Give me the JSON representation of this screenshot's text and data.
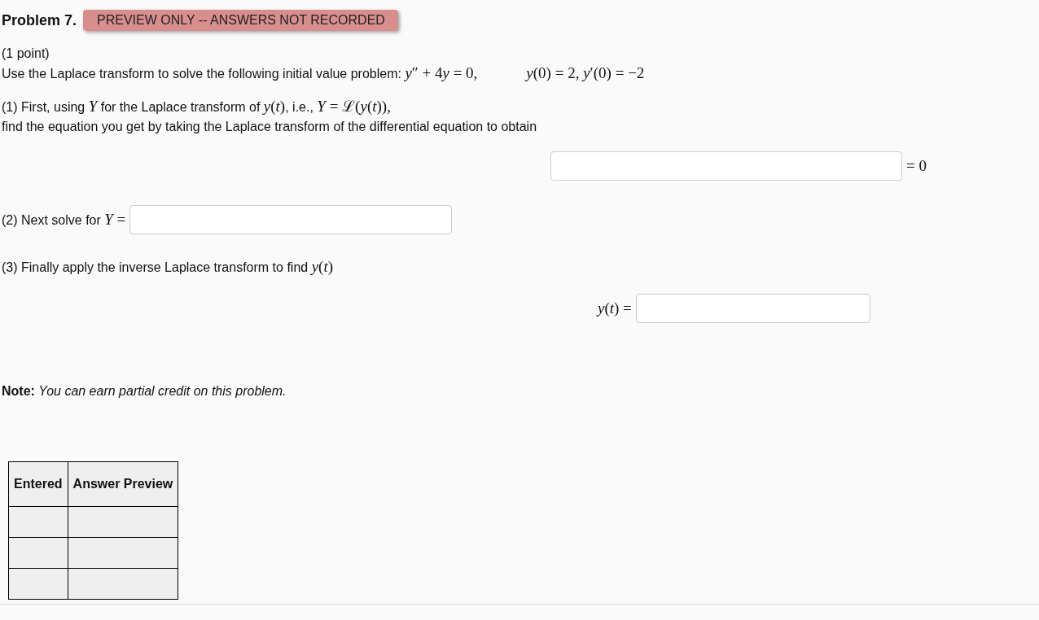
{
  "problem": {
    "title": "Problem 7.",
    "badge": "PREVIEW ONLY -- ANSWERS NOT RECORDED"
  },
  "points": "(1 point)",
  "statement": [
    {
      "kind": "text",
      "text": "Use the Laplace transform to solve the following initial value problem: "
    },
    {
      "kind": "math",
      "text": "*y*″ + 4"
    },
    {
      "kind": "math",
      "text": "*y* = 0,"
    },
    {
      "kind": "gap"
    },
    {
      "kind": "math",
      "text": "*y*(0) = 2,  *y*′(0) = −2"
    }
  ],
  "part1": {
    "line1": [
      {
        "kind": "text",
        "text": "(1) First, using "
      },
      {
        "kind": "math",
        "text": "*Y*"
      },
      {
        "kind": "text",
        "text": " for the Laplace transform of "
      },
      {
        "kind": "math",
        "text": "*y*(*t*)"
      },
      {
        "kind": "text",
        "text": ", i.e., "
      },
      {
        "kind": "math",
        "text": "*Y* = ℒ(*y*(*t*)),"
      }
    ],
    "line2": "find the equation you get by taking the Laplace transform of the differential equation to obtain",
    "suffix": "= 0"
  },
  "part2": {
    "label": [
      {
        "kind": "text",
        "text": "(2) Next solve for "
      },
      {
        "kind": "math",
        "text": "*Y* ="
      }
    ]
  },
  "part3": {
    "label": [
      {
        "kind": "text",
        "text": "(3) Finally apply the inverse Laplace transform to find "
      },
      {
        "kind": "math",
        "text": "*y*(*t*)"
      }
    ],
    "answer_label": "*y*(*t*) ="
  },
  "note": {
    "label": "Note:",
    "text": "You can earn partial credit on this problem."
  },
  "table": {
    "columns": [
      "Entered",
      "Answer Preview"
    ]
  }
}
